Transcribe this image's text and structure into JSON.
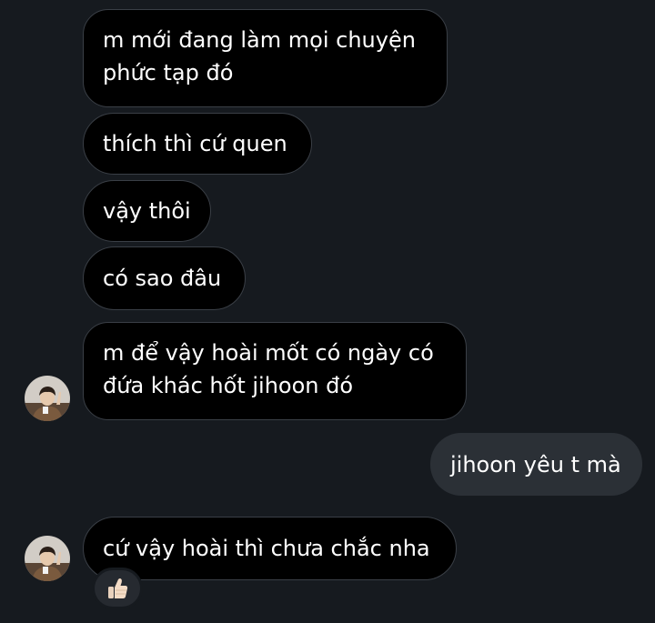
{
  "thread": {
    "messages": [
      {
        "sender": "other",
        "lines": [
          "m mới đang làm mọi chuyện",
          "phức tạp đó"
        ]
      },
      {
        "sender": "other",
        "lines": [
          "thích thì cứ quen"
        ]
      },
      {
        "sender": "other",
        "lines": [
          "vậy thôi"
        ]
      },
      {
        "sender": "other",
        "lines": [
          "có sao đâu"
        ]
      },
      {
        "sender": "other",
        "lines": [
          "m để vậy hoài mốt có ngày có",
          "đứa khác hốt jihoon đó"
        ]
      },
      {
        "sender": "me",
        "lines": [
          "jihoon yêu t mà"
        ]
      },
      {
        "sender": "other",
        "lines": [
          "cứ vậy hoài thì chưa chắc nha"
        ],
        "reaction": "thumbs-up-icon"
      }
    ]
  },
  "colors": {
    "background": "#161a1f",
    "received_bubble": "#000000",
    "received_border": "#3a3f46",
    "sent_bubble": "#2b3036",
    "text": "#ffffff"
  }
}
